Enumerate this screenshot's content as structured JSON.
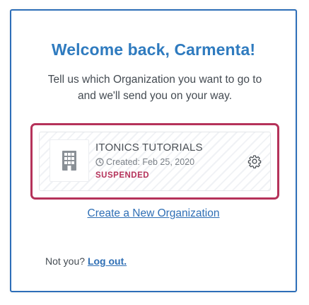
{
  "header": {
    "title": "Welcome back, Carmenta!",
    "subtitle": "Tell us which Organization you want to go to and we'll send you on your way."
  },
  "organizations": [
    {
      "name": "ITONICS TUTORIALS",
      "created": "Created: Feb 25, 2020",
      "status": "SUSPENDED",
      "logo_icon": "building-icon",
      "settings_icon": "gear-icon"
    }
  ],
  "actions": {
    "create_org_label": "Create a New Organization"
  },
  "footer": {
    "not_you_text": "Not you?",
    "logout_label": "Log out."
  },
  "colors": {
    "accent": "#2f7bbf",
    "link": "#2f6fb5",
    "highlight": "#b5325a",
    "status_suspended": "#b5325a"
  }
}
